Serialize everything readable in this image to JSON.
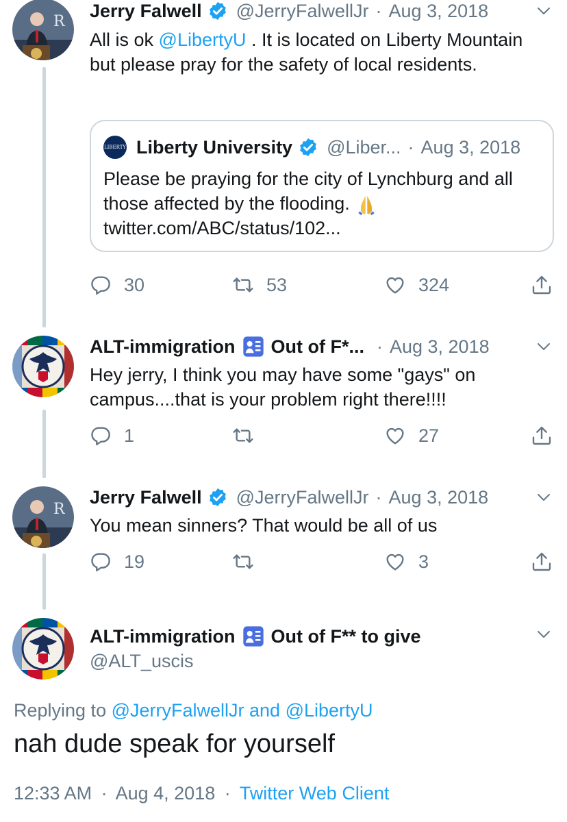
{
  "tweet1": {
    "name": "Jerry Falwell",
    "handle": "@JerryFalwellJr",
    "date": "Aug 3, 2018",
    "text_pre": "All is ok ",
    "mention": "@LibertyU",
    "text_post": " .  It is located on Liberty Mountain but please pray for the safety of local residents.",
    "quote": {
      "name": "Liberty University",
      "handle": "@Liber...",
      "date": "Aug 3, 2018",
      "avatar_text": "LIBERTY",
      "text": "Please be praying for the city of Lynchburg and all those affected by the flooding.",
      "link": "twitter.com/ABC/status/102..."
    },
    "replies": "30",
    "retweets": "53",
    "likes": "324"
  },
  "tweet2": {
    "name": "ALT-immigration",
    "name_suffix": "Out of F*...",
    "date": "Aug 3, 2018",
    "text": "Hey jerry, I think you may have some \"gays\" on campus....that is your problem right there!!!!",
    "replies": "1",
    "retweets": "",
    "likes": "27"
  },
  "tweet3": {
    "name": "Jerry Falwell",
    "handle": "@JerryFalwellJr",
    "date": "Aug 3, 2018",
    "text": "You mean sinners?  That would be all of us",
    "replies": "19",
    "retweets": "",
    "likes": "3"
  },
  "main": {
    "name": "ALT-immigration",
    "name_suffix": "Out of F** to give",
    "handle": "@ALT_uscis",
    "replying_prefix": "Replying to ",
    "replying_to_1": "@JerryFalwellJr",
    "replying_and": " and ",
    "replying_to_2": "@LibertyU",
    "text": "nah dude speak for yourself",
    "time": "12:33 AM",
    "date": "Aug 4, 2018",
    "client": "Twitter Web Client"
  },
  "icons": {
    "reply": "reply-icon",
    "retweet": "retweet-icon",
    "like": "heart-icon",
    "share": "share-icon",
    "verified": "verified-badge-icon",
    "chevron": "chevron-down-icon"
  },
  "colors": {
    "link": "#1da1f2",
    "muted": "#657786",
    "verified": "#1da1f2",
    "thread_line": "#ccd6dd"
  },
  "separator": "·"
}
